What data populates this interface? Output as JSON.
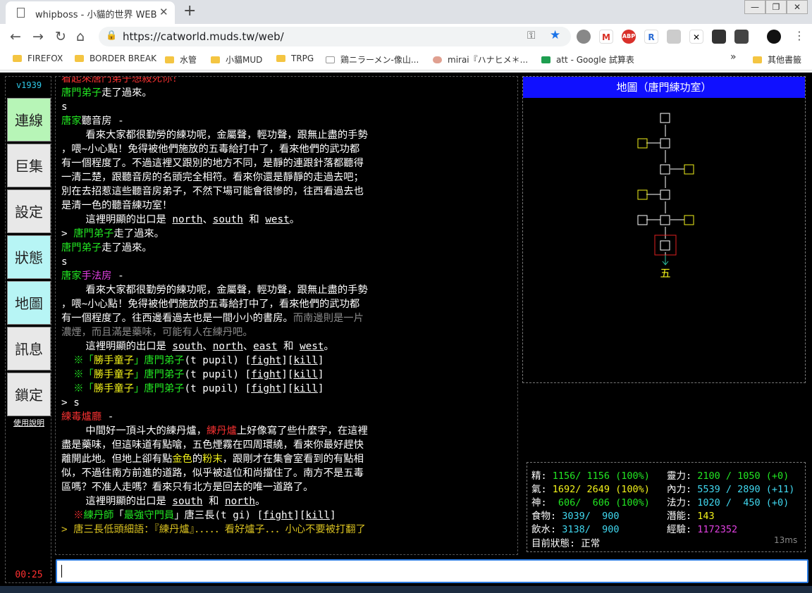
{
  "browser": {
    "tab_title": "whipboss - 小貓的世界 WEB",
    "url": "https://catworld.muds.tw/web/",
    "bookmarks": [
      "FIREFOX",
      "BORDER BREAK",
      "水管",
      "小貓MUD",
      "TRPG",
      "鶏ニラーメン-像山...",
      "mirai『ハナヒメ＊...",
      "att - Google 試算表",
      "»",
      "其他書籤"
    ]
  },
  "sidebar": {
    "version": "v1939",
    "buttons": [
      {
        "label": "連線",
        "color": "#b7f5b7"
      },
      {
        "label": "巨集",
        "color": "#e8e8e8"
      },
      {
        "label": "設定",
        "color": "#e8e8e8"
      },
      {
        "label": "狀態",
        "color": "#b7f5f5"
      },
      {
        "label": "地圖",
        "color": "#b7f5f5"
      },
      {
        "label": "訊息",
        "color": "#e8e8e8"
      },
      {
        "label": "鎖定",
        "color": "#e8e8e8"
      }
    ],
    "help": "使用說明",
    "clock": "00:25"
  },
  "output": {
    "lines": [
      [
        {
          "t": "看起來唐門弟子想殺死你！",
          "c": "r"
        }
      ],
      [
        {
          "t": "唐門弟子",
          "c": "g"
        },
        {
          "t": "走了過來。"
        }
      ],
      [
        {
          "t": "s"
        }
      ],
      [
        {
          "t": "唐家",
          "c": "g"
        },
        {
          "t": "聽音房 -"
        }
      ],
      [
        {
          "t": "    看來大家都很勤勞的練功呢，金屬聲，輕功聲，跟無止盡的手勢"
        }
      ],
      [
        {
          "t": "，喂~小心點！免得被他們施放的五毒給打中了，看來他們的武功都"
        }
      ],
      [
        {
          "t": "有一個程度了。不過這裡又跟別的地方不同，是靜的連跟針落都聽得"
        }
      ],
      [
        {
          "t": "一清二楚，跟聽音房的名頭完全相符。看來你還是靜靜的走過去吧；"
        }
      ],
      [
        {
          "t": "別在去招惹這些聽音房弟子，不然下場可能會很慘的，往西看過去也"
        }
      ],
      [
        {
          "t": "是清一色的聽音練功室！"
        }
      ],
      [
        {
          "t": "    這裡明顯的出口是 "
        },
        {
          "t": "north",
          "c": "u"
        },
        {
          "t": "、"
        },
        {
          "t": "south",
          "c": "u"
        },
        {
          "t": " 和 "
        },
        {
          "t": "west",
          "c": "u"
        },
        {
          "t": "。"
        }
      ],
      [
        {
          "t": "> "
        },
        {
          "t": "唐門弟子",
          "c": "g"
        },
        {
          "t": "走了過來。"
        }
      ],
      [
        {
          "t": "唐門弟子",
          "c": "g"
        },
        {
          "t": "走了過來。"
        }
      ],
      [
        {
          "t": "s"
        }
      ],
      [
        {
          "t": "唐家",
          "c": "g"
        },
        {
          "t": "手法房",
          "c": "m"
        },
        {
          "t": " -"
        }
      ],
      [
        {
          "t": "    看來大家都很勤勞的練功呢，金屬聲，輕功聲，跟無止盡的手勢"
        }
      ],
      [
        {
          "t": "，喂~小心點！免得被他們施放的五毒給打中了，看來他們的武功都"
        }
      ],
      [
        {
          "t": "有一個程度了。往西邊看過去也是一間小小的書房。"
        },
        {
          "t": "而南邊則是一片",
          "c": "gr"
        }
      ],
      [
        {
          "t": "濃煙，而且滿是藥味，可能有人在練丹吧。",
          "c": "gr"
        }
      ],
      [
        {
          "t": "    這裡明顯的出口是 "
        },
        {
          "t": "south",
          "c": "u"
        },
        {
          "t": "、"
        },
        {
          "t": "north",
          "c": "u"
        },
        {
          "t": "、"
        },
        {
          "t": "east",
          "c": "u"
        },
        {
          "t": " 和 "
        },
        {
          "t": "west",
          "c": "u"
        },
        {
          "t": "。"
        }
      ],
      [
        {
          "t": "  ※「",
          "c": "g"
        },
        {
          "t": "勝手童子",
          "c": "y"
        },
        {
          "t": "」",
          "c": "g"
        },
        {
          "t": "唐門弟子",
          "c": "g"
        },
        {
          "t": "(t pupil) ["
        },
        {
          "t": "fight",
          "c": "u"
        },
        {
          "t": "]["
        },
        {
          "t": "kill",
          "c": "u"
        },
        {
          "t": "]"
        }
      ],
      [
        {
          "t": "  ※「",
          "c": "g"
        },
        {
          "t": "勝手童子",
          "c": "y"
        },
        {
          "t": "」",
          "c": "g"
        },
        {
          "t": "唐門弟子",
          "c": "g"
        },
        {
          "t": "(t pupil) ["
        },
        {
          "t": "fight",
          "c": "u"
        },
        {
          "t": "]["
        },
        {
          "t": "kill",
          "c": "u"
        },
        {
          "t": "]"
        }
      ],
      [
        {
          "t": "  ※「",
          "c": "g"
        },
        {
          "t": "勝手童子",
          "c": "y"
        },
        {
          "t": "」",
          "c": "g"
        },
        {
          "t": "唐門弟子",
          "c": "g"
        },
        {
          "t": "(t pupil) ["
        },
        {
          "t": "fight",
          "c": "u"
        },
        {
          "t": "]["
        },
        {
          "t": "kill",
          "c": "u"
        },
        {
          "t": "]"
        }
      ],
      [
        {
          "t": "> s"
        }
      ],
      [
        {
          "t": "練毒爐廳",
          "c": "r"
        },
        {
          "t": " -"
        }
      ],
      [
        {
          "t": "    中間好一頂斗大的練丹爐，"
        },
        {
          "t": "練丹爐",
          "c": "r"
        },
        {
          "t": "上好像寫了些什麼字，在這裡"
        }
      ],
      [
        {
          "t": "盡是藥味，但這味道有點嗆，五色煙霧在四周環繞，看來你最好趕快"
        }
      ],
      [
        {
          "t": "離開此地。但地上卻有點"
        },
        {
          "t": "金色",
          "c": "y"
        },
        {
          "t": "的"
        },
        {
          "t": "粉末",
          "c": "y"
        },
        {
          "t": "，跟剛才在集會室看到的有點相"
        }
      ],
      [
        {
          "t": "似，不過往南方前進的道路，似乎被這位和尚擋住了。南方不是五毒"
        }
      ],
      [
        {
          "t": "區嗎？不准人走嗎？看來只有北方是回去的唯一道路了。"
        }
      ],
      [
        {
          "t": "    這裡明顯的出口是 "
        },
        {
          "t": "south",
          "c": "u"
        },
        {
          "t": " 和 "
        },
        {
          "t": "north",
          "c": "u"
        },
        {
          "t": "。"
        }
      ],
      [
        {
          "t": "  ※",
          "c": "r"
        },
        {
          "t": "練丹師",
          "c": "g"
        },
        {
          "t": "「"
        },
        {
          "t": "最強守門員",
          "c": "g"
        },
        {
          "t": "」唐三長(t gi) ["
        },
        {
          "t": "fight",
          "c": "u"
        },
        {
          "t": "]["
        },
        {
          "t": "kill",
          "c": "u"
        },
        {
          "t": "]"
        }
      ],
      [
        {
          "t": "> ",
          "c": "dy"
        },
        {
          "t": "唐三長低頭細語：『練丹爐』．．．．．看好爐子．．．小心不要被打翻了",
          "c": "dy"
        }
      ]
    ]
  },
  "map": {
    "title": "地圖（唐門練功室）",
    "exit_label": "五",
    "colors": {
      "room": "#ffffff",
      "side_room": "#f2f21a",
      "current": "#e02020",
      "exit_arrow": "#2ec9a8"
    }
  },
  "stats": {
    "rows": [
      {
        "l1": "精:",
        "v1": " 1156/ 1156 (100%)",
        "c1": "cg",
        "l2": "靈力:",
        "v2": " 2100 / 1050 (+0)",
        "c2": "cg"
      },
      {
        "l1": "氣:",
        "v1": " 1692/ 2649 (100%)",
        "c1": "cy",
        "l2": "內力:",
        "v2": " 5539 / 2890 (+11)",
        "c2": "cc"
      },
      {
        "l1": "神:",
        "v1": "  606/  606 (100%)",
        "c1": "cg",
        "l2": "法力:",
        "v2": " 1020 /  450 (+0)",
        "c2": "cc"
      },
      {
        "l1": "食物:",
        "v1": " 3039/  900",
        "c1": "cc",
        "l2": "潛能:",
        "v2": " 143",
        "c2": "cy"
      },
      {
        "l1": "飲水:",
        "v1": " 3138/  900",
        "c1": "cc",
        "l2": "經驗:",
        "v2": " 1172352",
        "c2": "cm"
      }
    ],
    "status_label": "目前狀態:",
    "status_value": " 正常",
    "latency": "13ms"
  }
}
